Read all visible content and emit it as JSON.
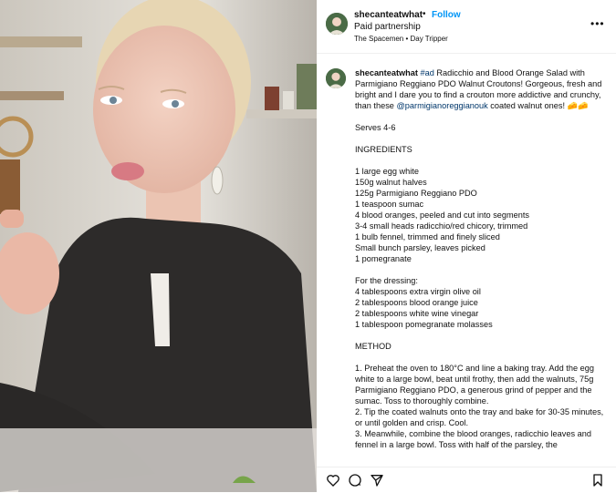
{
  "header": {
    "username": "shecanteatwhat",
    "separator": "•",
    "follow_label": "Follow",
    "paid_label": "Paid partnership",
    "music": "The Spacemen • Day Tripper",
    "more_label": "•••"
  },
  "caption": {
    "username": "shecanteatwhat",
    "hashtag": "#ad",
    "intro_1": "Radicchio and Blood Orange Salad with Parmigiano Reggiano PDO Walnut Croutons! Gorgeous, fresh and bright and I dare you to find a crouton more addictive and crunchy, than these",
    "mention": "@parmigianoreggianouk",
    "intro_2": "coated walnut ones! 🧀🧀",
    "serves": "Serves 4-6",
    "ingredients_heading": "INGREDIENTS",
    "ingredients": [
      "1 large egg white",
      "150g walnut halves",
      "125g Parmigiano Reggiano PDO",
      "1 teaspoon sumac",
      "4 blood oranges, peeled and cut into segments",
      "3-4 small heads radicchio/red chicory, trimmed",
      "1 bulb fennel, trimmed and finely sliced",
      "Small bunch parsley, leaves picked",
      "1 pomegranate"
    ],
    "dressing_heading": "For the dressing:",
    "dressing": [
      "4 tablespoons extra virgin olive oil",
      "2 tablespoons blood orange juice",
      "2 tablespoons white wine vinegar",
      "1 tablespoon pomegranate molasses"
    ],
    "method_heading": "METHOD",
    "method": [
      "1. Preheat the oven to 180°C and line a baking tray. Add the egg white to a large bowl, beat until frothy, then add the walnuts, 75g Parmigiano Reggiano PDO, a generous grind of pepper and the sumac. Toss to thoroughly combine.",
      "2. Tip the coated walnuts onto the tray and bake for 30-35 minutes, or until golden and crisp. Cool.",
      "3. Meanwhile, combine the blood oranges, radicchio leaves and fennel in a large bowl. Toss with half of the parsley, the"
    ]
  },
  "icons": {
    "like": "heart-icon",
    "comment": "comment-icon",
    "share": "share-icon",
    "save": "bookmark-icon"
  },
  "colors": {
    "link": "#0095f6",
    "tag": "#00376b",
    "text": "#111111"
  }
}
